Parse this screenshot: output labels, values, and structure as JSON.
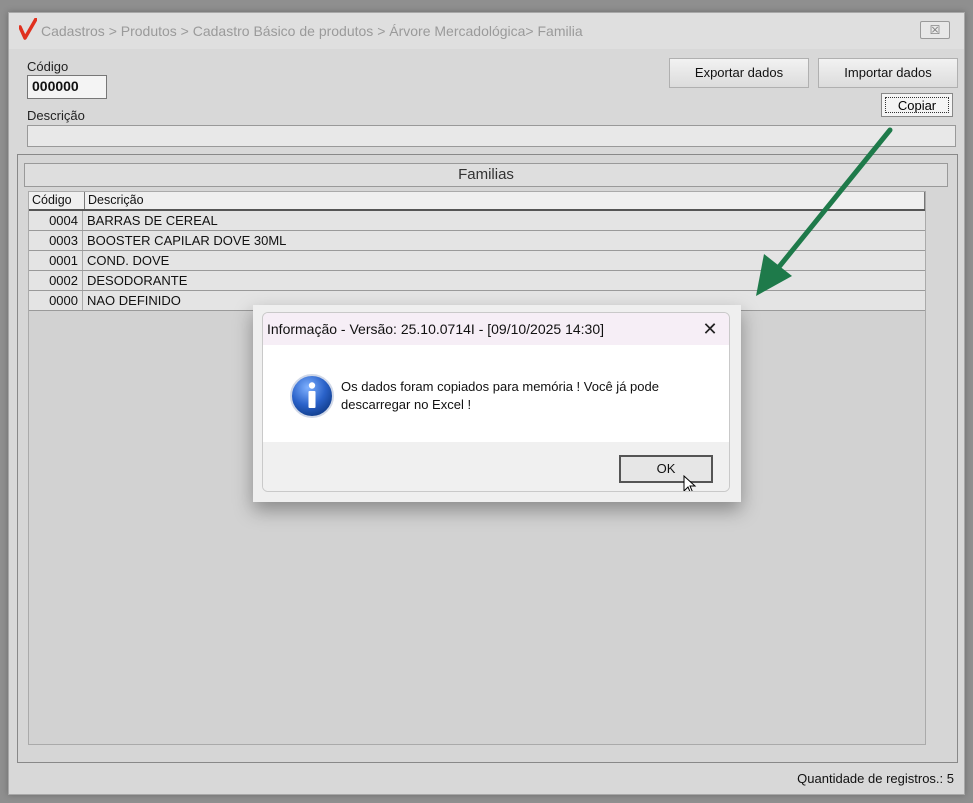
{
  "window": {
    "title": "Cadastros > Produtos > Cadastro Básico de produtos > Árvore Mercadológica> Familia",
    "close_glyph": "☒"
  },
  "form": {
    "codigo_label": "Código",
    "codigo_value": "000000",
    "descricao_label": "Descrição",
    "descricao_value": ""
  },
  "toolbar": {
    "exportar_label": "Exportar dados",
    "importar_label": "Importar dados",
    "copiar_label": "Copiar"
  },
  "panel": {
    "title": "Familias",
    "columns": [
      "Código",
      "Descrição"
    ],
    "rows": [
      {
        "code": "0004",
        "desc": "BARRAS DE CEREAL"
      },
      {
        "code": "0003",
        "desc": "BOOSTER CAPILAR DOVE 30ML"
      },
      {
        "code": "0001",
        "desc": "COND. DOVE"
      },
      {
        "code": "0002",
        "desc": "DESODORANTE"
      },
      {
        "code": "0000",
        "desc": "NAO DEFINIDO"
      }
    ]
  },
  "status": {
    "records_text": "Quantidade de registros.: 5"
  },
  "dialog": {
    "title": "Informação - Versão: 25.10.0714I - [09/10/2025 14:30]",
    "message_line1": "Os dados foram copiados para memória ! Você já pode",
    "message_line2": "descarregar no Excel !",
    "ok_label": "OK",
    "close_glyph": "✕",
    "icon": "info-icon"
  },
  "colors": {
    "arrow": "#1e7a4a",
    "logo": "#e0301e",
    "info_blue": "#2a62c9"
  }
}
